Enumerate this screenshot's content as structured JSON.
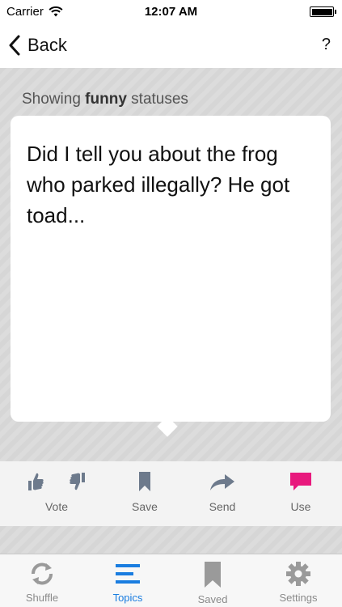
{
  "status_bar": {
    "carrier": "Carrier",
    "time": "12:07 AM"
  },
  "nav": {
    "back_label": "Back",
    "help_label": "?"
  },
  "header": {
    "prefix": "Showing",
    "topic": "funny",
    "suffix": "statuses"
  },
  "card": {
    "text": "Did I tell you about the frog who parked illegally? He got toad..."
  },
  "actions": [
    {
      "id": "vote",
      "label": "Vote",
      "icon": "thumbs-icons"
    },
    {
      "id": "save",
      "label": "Save",
      "icon": "bookmark-icon"
    },
    {
      "id": "send",
      "label": "Send",
      "icon": "share-arrow-icon"
    },
    {
      "id": "use",
      "label": "Use",
      "icon": "speech-bubble-icon",
      "color": "#e8197d"
    }
  ],
  "tabs": [
    {
      "id": "shuffle",
      "label": "Shuffle",
      "icon": "shuffle-icon"
    },
    {
      "id": "topics",
      "label": "Topics",
      "icon": "list-icon",
      "active": true,
      "color": "#1a7de0"
    },
    {
      "id": "saved",
      "label": "Saved",
      "icon": "bookmark-icon"
    },
    {
      "id": "settings",
      "label": "Settings",
      "icon": "gear-icon"
    }
  ]
}
